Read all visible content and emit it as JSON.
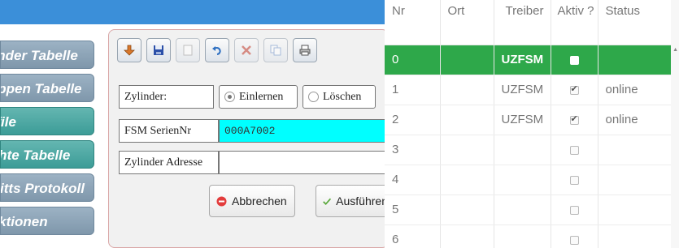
{
  "sidebar": {
    "items": [
      {
        "label": "Zylinder Tabelle",
        "active": false
      },
      {
        "label": "Gruppen Tabelle",
        "active": false
      },
      {
        "label": "Profile",
        "active": true
      },
      {
        "label": "Rechte Tabelle",
        "active": true
      },
      {
        "label": "Zutritts Protokoll",
        "active": false
      },
      {
        "label": "Funktionen",
        "active": false
      }
    ]
  },
  "toolbar": {
    "icons": [
      "import-icon",
      "save-icon",
      "new-icon",
      "undo-icon",
      "delete-icon",
      "copy-icon",
      "print-icon"
    ]
  },
  "form": {
    "zylinder_label": "Zylinder:",
    "radio_einlernen": "Einlernen",
    "radio_loeschen": "Löschen",
    "serial_label": "FSM SerienNr",
    "serial_value": "000A7002",
    "adresse_label": "Zylinder Adresse",
    "adresse_value": "",
    "cancel_label": "Abbrechen",
    "execute_label": "Ausführen"
  },
  "table": {
    "columns": [
      "Nr",
      "Ort",
      "Treiber",
      "Aktiv ?",
      "Status"
    ],
    "rows": [
      {
        "nr": "0",
        "ort": "",
        "treiber": "UZFSM",
        "aktiv": false,
        "status": "",
        "selected": true
      },
      {
        "nr": "1",
        "ort": "",
        "treiber": "UZFSM",
        "aktiv": true,
        "status": "online",
        "selected": false
      },
      {
        "nr": "2",
        "ort": "",
        "treiber": "UZFSM",
        "aktiv": true,
        "status": "online",
        "selected": false
      },
      {
        "nr": "3",
        "ort": "",
        "treiber": "",
        "aktiv": false,
        "status": "",
        "selected": false
      },
      {
        "nr": "4",
        "ort": "",
        "treiber": "",
        "aktiv": false,
        "status": "",
        "selected": false
      },
      {
        "nr": "5",
        "ort": "",
        "treiber": "",
        "aktiv": false,
        "status": "",
        "selected": false
      },
      {
        "nr": "6",
        "ort": "",
        "treiber": "",
        "aktiv": false,
        "status": "",
        "selected": false
      }
    ]
  },
  "colors": {
    "topbar": "#3b8fd9",
    "selected_row": "#2ea84a",
    "serial_bg": "#00ffff"
  }
}
